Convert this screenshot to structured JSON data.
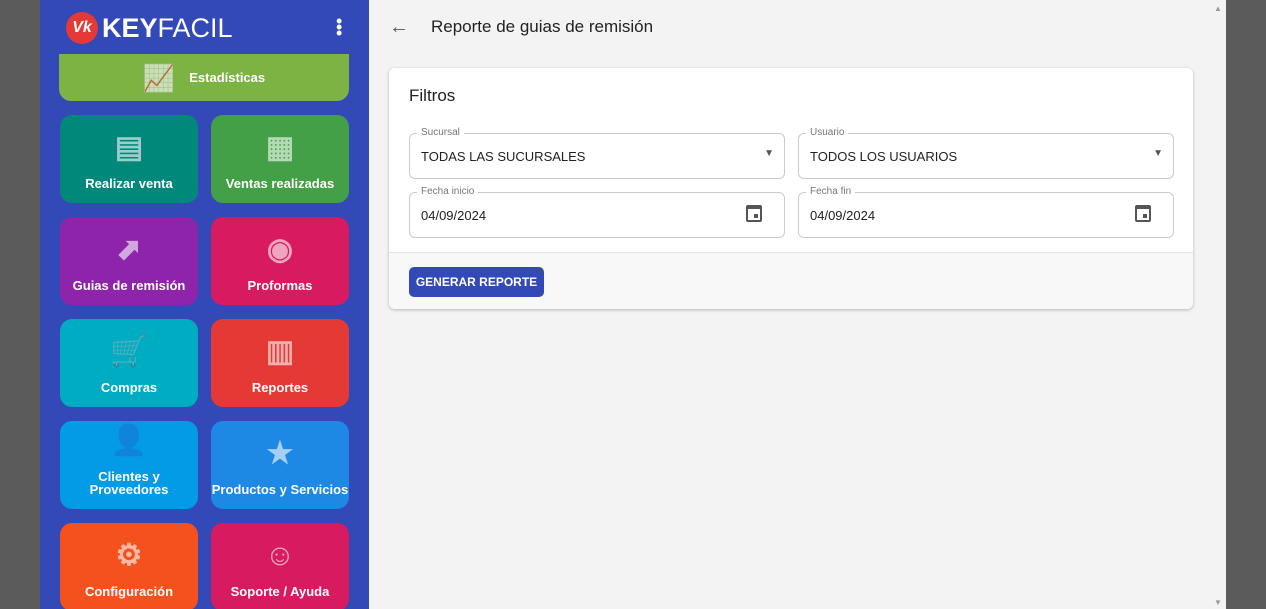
{
  "app": {
    "logo_mark": "Vk",
    "brand_bold": "KEY",
    "brand_light": "FACIL"
  },
  "sidebar": {
    "tiles": [
      {
        "label": "Estadísticas",
        "icon": "chart-trend-icon",
        "color": "#7cb342"
      },
      {
        "label": "Realizar venta",
        "icon": "receipt-icon",
        "color": "#00897b"
      },
      {
        "label": "Ventas realizadas",
        "icon": "spreadsheet-icon",
        "color": "#43a047"
      },
      {
        "label": "Guias de remisión",
        "icon": "file-arrow-icon",
        "color": "#8e24aa"
      },
      {
        "label": "Proformas",
        "icon": "file-eye-icon",
        "color": "#d81b60"
      },
      {
        "label": "Compras",
        "icon": "cart-icon",
        "color": "#00acc1"
      },
      {
        "label": "Reportes",
        "icon": "report-chart-icon",
        "color": "#e53935"
      },
      {
        "label": "Clientes y Proveedores",
        "icon": "folder-user-icon",
        "color": "#039be5"
      },
      {
        "label": "Productos y Servicios",
        "icon": "folder-star-icon",
        "color": "#1e88e5"
      },
      {
        "label": "Configuración",
        "icon": "gear-icon",
        "color": "#f4511e"
      },
      {
        "label": "Soporte / Ayuda",
        "icon": "support-agent-icon",
        "color": "#d81b60"
      }
    ]
  },
  "header": {
    "title": "Reporte de guias de remisión"
  },
  "filters": {
    "title": "Filtros",
    "sucursal": {
      "label": "Sucursal",
      "value": "TODAS LAS SUCURSALES"
    },
    "usuario": {
      "label": "Usuario",
      "value": "TODOS LOS USUARIOS"
    },
    "fecha_inicio": {
      "label": "Fecha inicio",
      "value": "04/09/2024"
    },
    "fecha_fin": {
      "label": "Fecha fin",
      "value": "04/09/2024"
    },
    "generate_label": "GENERAR REPORTE"
  }
}
